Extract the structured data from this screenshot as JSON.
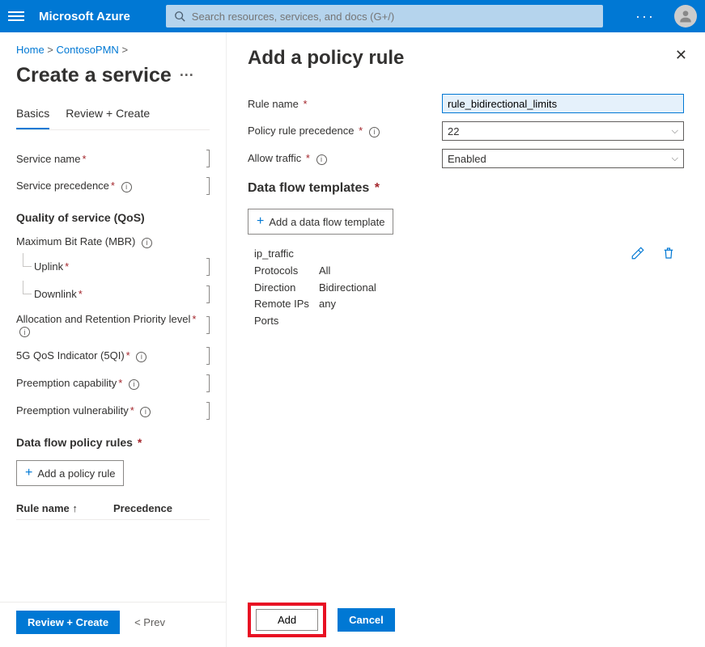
{
  "topbar": {
    "brand": "Microsoft Azure",
    "search_placeholder": "Search resources, services, and docs (G+/)"
  },
  "crumbs": {
    "home": "Home",
    "parent": "ContosoPMN"
  },
  "page_title": "Create a service",
  "tabs": {
    "basics": "Basics",
    "review": "Review + Create"
  },
  "fields": {
    "service_name": "Service name",
    "service_precedence": "Service precedence",
    "qos_heading": "Quality of service (QoS)",
    "mbr": "Maximum Bit Rate (MBR)",
    "uplink": "Uplink",
    "downlink": "Downlink",
    "arp": "Allocation and Retention Priority level",
    "qos5g": "5G QoS Indicator (5QI)",
    "preempt_cap": "Preemption capability",
    "preempt_vul": "Preemption vulnerability",
    "rules_heading": "Data flow policy rules",
    "add_rule": "Add a policy rule",
    "col_rule": "Rule name",
    "col_prec": "Precedence"
  },
  "footer": {
    "review": "Review + Create",
    "prev": "< Prev"
  },
  "panel": {
    "title": "Add a policy rule",
    "rule_name_label": "Rule name",
    "rule_name_value": "rule_bidirectional_limits",
    "precedence_label": "Policy rule precedence",
    "precedence_value": "22",
    "allow_label": "Allow traffic",
    "allow_value": "Enabled",
    "templates_heading": "Data flow templates",
    "add_template": "Add a data flow template",
    "template": {
      "name": "ip_traffic",
      "protocols_k": "Protocols",
      "protocols_v": "All",
      "direction_k": "Direction",
      "direction_v": "Bidirectional",
      "remoteips_k": "Remote IPs",
      "remoteips_v": "any",
      "ports_k": "Ports",
      "ports_v": ""
    },
    "add": "Add",
    "cancel": "Cancel"
  }
}
